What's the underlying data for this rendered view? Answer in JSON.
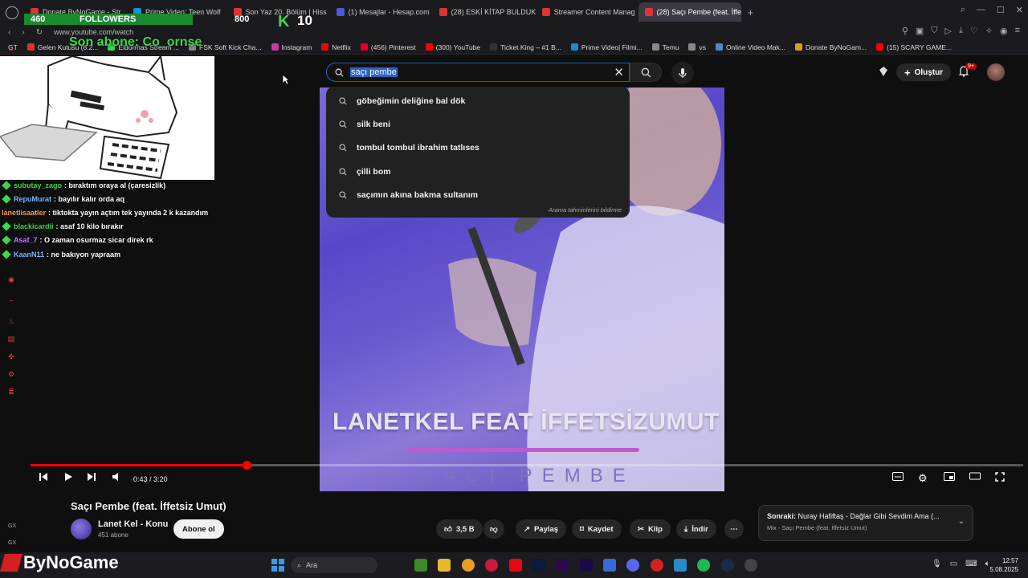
{
  "browser": {
    "tabs": [
      {
        "label": "Donate ByNoGame - Str",
        "color": "#d33"
      },
      {
        "label": "Prime Video: Teen Wolf",
        "color": "#1a8ad4"
      },
      {
        "label": "Son Yaz 20. Bölüm | Hiss",
        "color": "#d33"
      },
      {
        "label": "(1) Mesajlar - Hesap.com",
        "color": "#4a5ad8"
      },
      {
        "label": "(28) ESKİ KİTAP BULDUK",
        "color": "#d33"
      },
      {
        "label": "Streamer Content Manag",
        "color": "#d33"
      },
      {
        "label": "(28) Saçı Pembe (feat. İffe",
        "color": "#d33"
      }
    ],
    "url": "www.youtube.com/watch",
    "bookmarks": [
      "GT",
      "Gelen Kutusu (8.2...",
      "Eldorrnas Stream ...",
      "FSK Soft Kick Cha...",
      "Instagram",
      "Netflix",
      "(456) Pinterest",
      "(300) YouTube",
      "Ticket King – #1 B...",
      "Prime Video| Filmi...",
      "Temu",
      "vs",
      "Online Video Mak...",
      "Donate ByNoGam...",
      "(15) SCARY GAME..."
    ]
  },
  "overlay": {
    "followers_count": "460",
    "followers_label": "FOLLOWERS",
    "viewers": "800",
    "k_logo": "K",
    "k_count": "10",
    "last_sub": "Son abone: Co_ornse"
  },
  "youtube": {
    "search_query": "saçı pembe",
    "suggestions": [
      "göbeğimin deliğine bal dök",
      "silk beni",
      "tombul tombul ibrahim tatlıses",
      "çilli bom",
      "saçımın akına bakma sultanım"
    ],
    "suggestion_footer": "Arama tahminlerini bildirme",
    "create_label": "Oluştur",
    "notif_count": "9+"
  },
  "chat": [
    {
      "user": "subutay_zago",
      "user_color": "#3ad94a",
      "text": " : bıraktım oraya al (çaresizlik)"
    },
    {
      "user": "RepuMurat",
      "user_color": "#7ab8ff",
      "text": " : bayılır kalır orda aq"
    },
    {
      "user": "lanetlisaatler",
      "user_color": "#ff9a3a",
      "text": " : tiktokta yayın açtım tek yayında 2 k kazandım"
    },
    {
      "user": "blackicardii",
      "user_color": "#3ad94a",
      "text": " : asaf 10 kilo bırakır"
    },
    {
      "user": "Asaf_7",
      "user_color": "#c87aff",
      "text": " : O zaman osurmaz sicar direk rk"
    },
    {
      "user": "KaanN11",
      "user_color": "#7ab8ff",
      "text": " : ne bakıyon yapraam"
    }
  ],
  "video": {
    "overlay_title": "LANETKEL FEAT İFFETSİZUMUT",
    "overlay_subtitle": "SAÇI PEMBE",
    "time": "0:43 / 3:20",
    "progress": 0.218
  },
  "watch": {
    "title": "Saçı Pembe (feat. İffetsiz Umut)",
    "channel": "Lanet Kel - Konu",
    "subscribers": "451 abone",
    "subscribe_label": "Abone ol",
    "likes": "3,5 B",
    "share_label": "Paylaş",
    "save_label": "Kaydet",
    "clip_label": "Klip",
    "download_label": "İndir",
    "next_prefix": "Sonraki:",
    "next_title": "Nuray Hafiftaş - Dağlar Gibi Sevdim Ama (...",
    "next_mix": "Mix - Saçı Pembe (feat. İffetsiz Umut)"
  },
  "taskbar": {
    "brand": "ByNoGame",
    "search_label": "Ara",
    "time": "12:57",
    "date": "5.08.2025"
  },
  "side_labels": [
    "GX",
    "GX"
  ]
}
